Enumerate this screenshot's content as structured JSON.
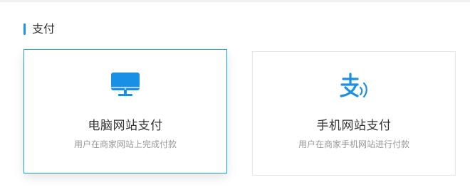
{
  "section": {
    "title": "支付"
  },
  "colors": {
    "accent": "#1890ff",
    "selected_border": "#1aa0e8",
    "icon_blue": "#1a8fe6"
  },
  "payment_options": [
    {
      "title": "电脑网站支付",
      "description": "用户在商家网站上完成付款",
      "icon": "desktop-monitor-icon",
      "selected": true
    },
    {
      "title": "手机网站支付",
      "description": "用户在商家手机网站进行付款",
      "icon": "alipay-mobile-icon",
      "selected": false
    }
  ]
}
